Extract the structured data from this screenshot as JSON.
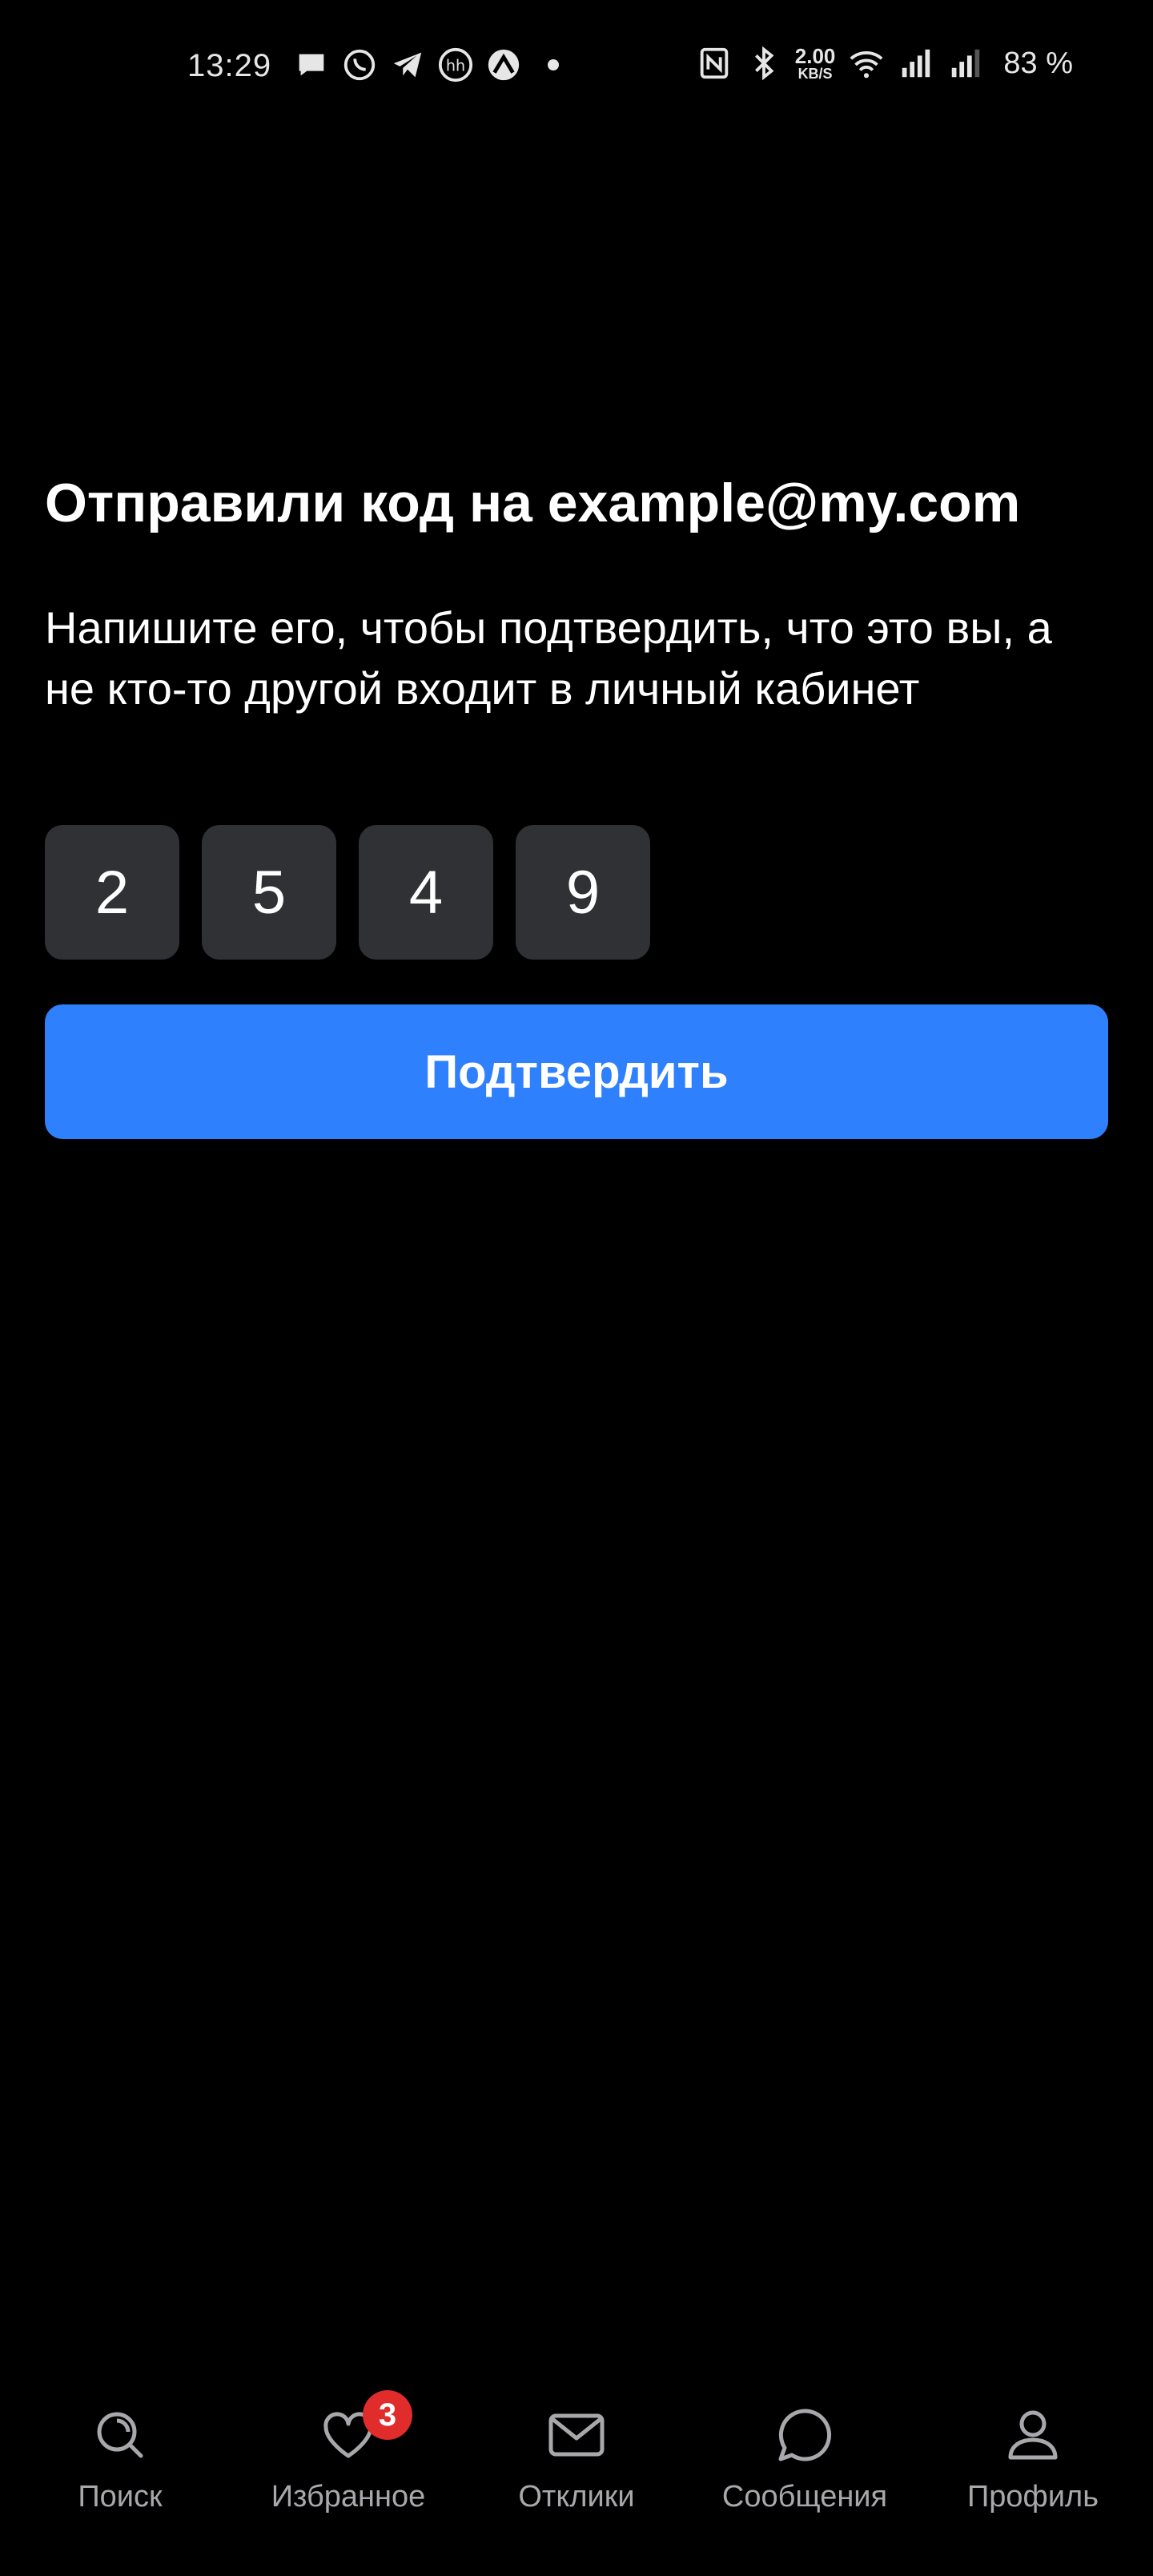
{
  "status_bar": {
    "time": "13:29",
    "left_icons": [
      "chat-bubble-icon",
      "whatsapp-icon",
      "telegram-icon",
      "hh-icon",
      "app-icon"
    ],
    "network_speed_value": "2.00",
    "network_speed_unit": "KB/S",
    "battery": "83 %"
  },
  "verify": {
    "title": "Отправили код на example@my.com",
    "subtitle": "Напишите его, чтобы подтвердить, что это вы, а не кто-то другой входит в личный кабинет",
    "code_digits": [
      "2",
      "5",
      "4",
      "9"
    ],
    "confirm_label": "Подтвердить"
  },
  "nav": {
    "items": [
      {
        "label": "Поиск",
        "icon": "search-icon"
      },
      {
        "label": "Избранное",
        "icon": "heart-icon",
        "badge": "3"
      },
      {
        "label": "Отклики",
        "icon": "envelope-icon"
      },
      {
        "label": "Сообщения",
        "icon": "chat-icon"
      },
      {
        "label": "Профиль",
        "icon": "profile-icon"
      }
    ]
  },
  "colors": {
    "background": "#000000",
    "accent": "#2f80fc",
    "code_cell": "#303134",
    "badge": "#e12c2c",
    "nav_label": "#a8a8ac"
  }
}
